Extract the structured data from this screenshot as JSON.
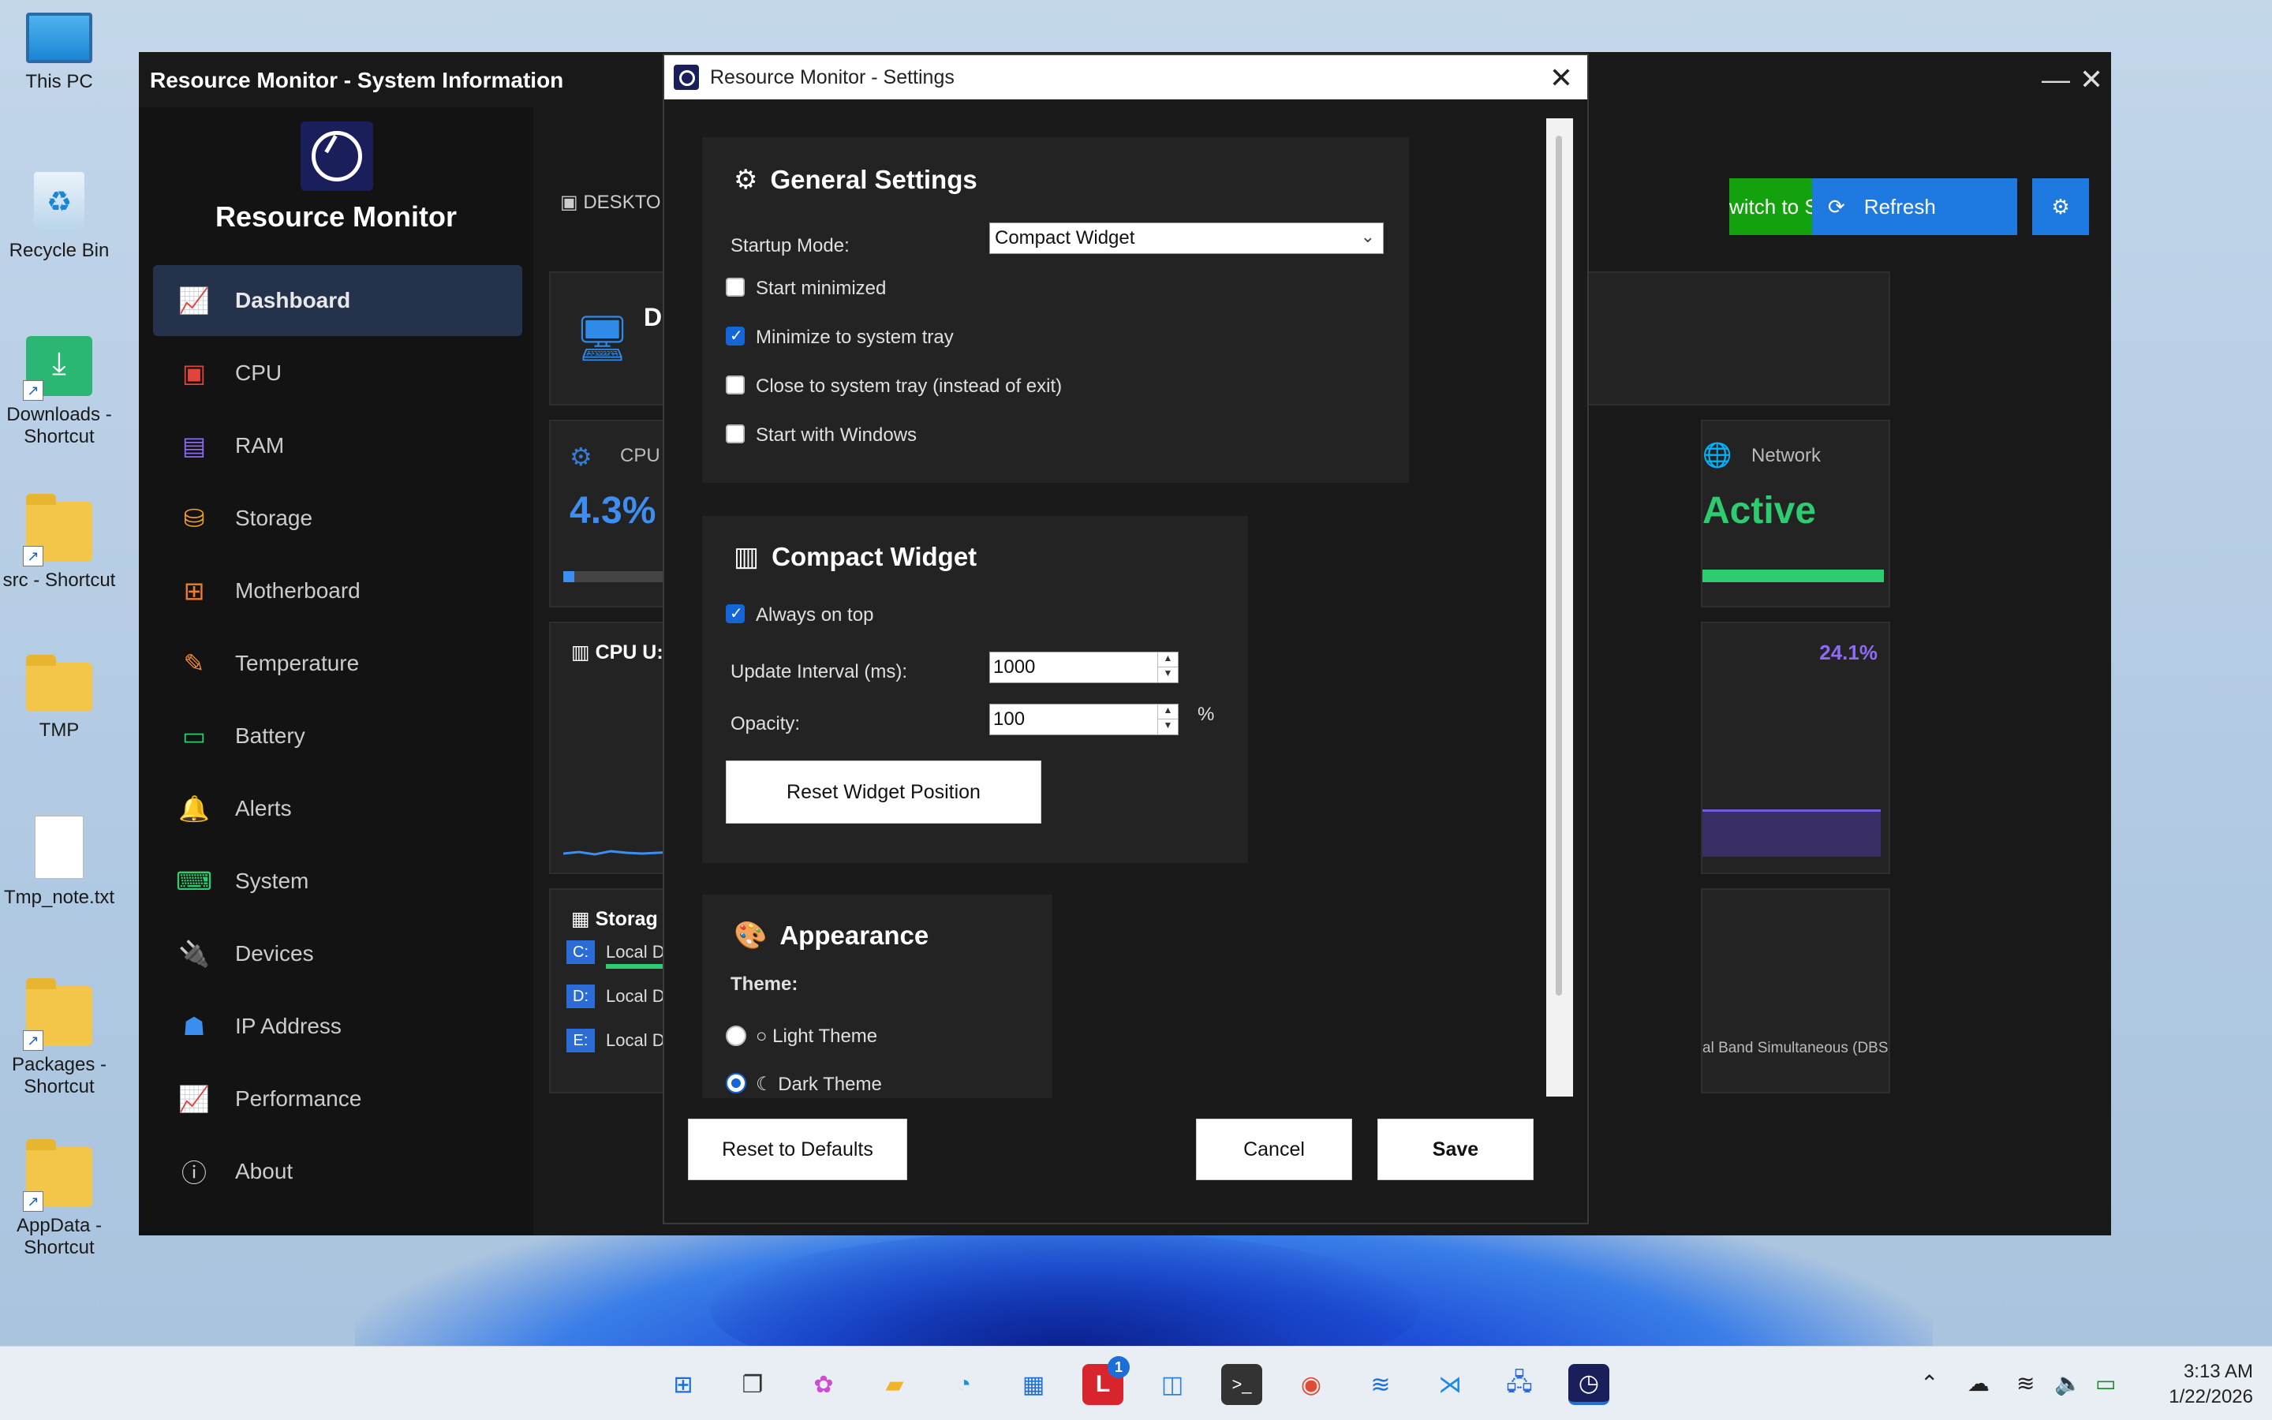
{
  "desktop": {
    "icons": [
      {
        "label": "This PC"
      },
      {
        "label": "Recycle Bin"
      },
      {
        "label": "Downloads - Shortcut"
      },
      {
        "label": "src - Shortcut"
      },
      {
        "label": "TMP"
      },
      {
        "label": "Tmp_note.txt"
      },
      {
        "label": "Packages - Shortcut"
      },
      {
        "label": "AppData - Shortcut"
      }
    ]
  },
  "main_window": {
    "title": "Resource Monitor - System Information",
    "brand": "Resource Monitor",
    "nav": [
      {
        "label": "Dashboard",
        "icon": "chart-line-icon",
        "color": "#5b8def"
      },
      {
        "label": "CPU",
        "icon": "chip-icon",
        "color": "#e0443a"
      },
      {
        "label": "RAM",
        "icon": "memory-icon",
        "color": "#8a6bf0"
      },
      {
        "label": "Storage",
        "icon": "database-icon",
        "color": "#f2a12b"
      },
      {
        "label": "Motherboard",
        "icon": "sitemap-icon",
        "color": "#f07c2b"
      },
      {
        "label": "Temperature",
        "icon": "thermometer-icon",
        "color": "#f08a3a"
      },
      {
        "label": "Battery",
        "icon": "battery-icon",
        "color": "#2ecc71"
      },
      {
        "label": "Alerts",
        "icon": "bell-icon",
        "color": "#f2c12b"
      },
      {
        "label": "System",
        "icon": "system-icon",
        "color": "#2ecc71"
      },
      {
        "label": "Devices",
        "icon": "plug-icon",
        "color": "#b05cf0"
      },
      {
        "label": "IP Address",
        "icon": "network-icon",
        "color": "#3a8ef0"
      },
      {
        "label": "Performance",
        "icon": "performance-icon",
        "color": "#2ecc71"
      },
      {
        "label": "About",
        "icon": "info-icon",
        "color": "#cccccc"
      }
    ],
    "header": {
      "computer_label": "DESKTO",
      "switch_btn": "witch to Small UI",
      "refresh_btn": "Refresh"
    },
    "cards": {
      "sys_initial": "D",
      "cpu_label": "CPU",
      "cpu_value": "4.3%",
      "network_label": "Network",
      "network_value": "Active",
      "cpu_usage_title": "CPU U:",
      "percent_right": "24.1%",
      "storage_title": "Storag",
      "drives": [
        {
          "letter": "C:",
          "name": "Local D"
        },
        {
          "letter": "D:",
          "name": "Local D"
        },
        {
          "letter": "E:",
          "name": "Local D"
        }
      ],
      "adapter_text": "al Band Simultaneous (DBS) WiFiCx Net..."
    }
  },
  "settings_dialog": {
    "title": "Resource Monitor - Settings",
    "general": {
      "title": "General Settings",
      "startup_label": "Startup Mode:",
      "startup_value": "Compact Widget",
      "start_minimized": "Start minimized",
      "minimize_tray": "Minimize to system tray",
      "close_tray": "Close to system tray (instead of exit)",
      "start_windows": "Start with Windows"
    },
    "compact": {
      "title": "Compact Widget",
      "always_on_top": "Always on top",
      "interval_label": "Update Interval (ms):",
      "interval_value": "1000",
      "opacity_label": "Opacity:",
      "opacity_value": "100",
      "percent": "%",
      "reset_pos": "Reset Widget Position"
    },
    "appearance": {
      "title": "Appearance",
      "theme_label": "Theme:",
      "light": "Light Theme",
      "dark": "Dark Theme"
    },
    "footer": {
      "reset": "Reset to Defaults",
      "cancel": "Cancel",
      "save": "Save"
    }
  },
  "taskbar": {
    "time": "3:13 AM",
    "date": "1/22/2026",
    "badge": "1"
  }
}
